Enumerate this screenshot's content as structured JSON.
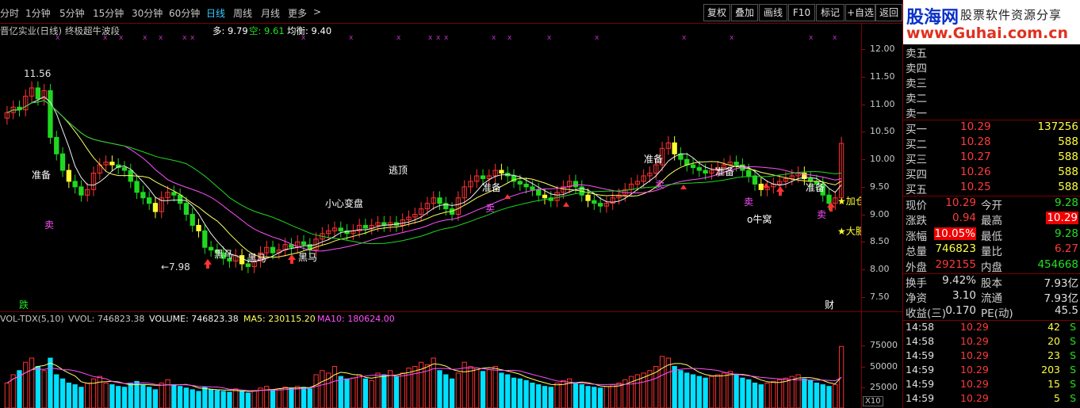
{
  "periods": [
    "分时",
    "1分钟",
    "5分钟",
    "15分钟",
    "30分钟",
    "60分钟",
    "日线",
    "周线",
    "月线",
    "更多"
  ],
  "active_period": "日线",
  "more_arrow": ">",
  "toolbar": {
    "fuquan": "复权",
    "diejia": "叠加",
    "huaxian": "画线",
    "f10": "F10",
    "biaoji": "标记",
    "zixuan": "+自选",
    "fanhui": "返回"
  },
  "chart_title": {
    "name": "晋亿实业(日线)",
    "indicator": "终极超牛波段",
    "duo": "多: 9.79",
    "kong": "空: 9.61",
    "junheng": "均衡: 9.40"
  },
  "price_axis": [
    "12.00",
    "11.50",
    "11.00",
    "10.50",
    "10.00",
    "9.50",
    "9.00",
    "8.50",
    "8.00",
    "7.50"
  ],
  "volume_axis": [
    "75000",
    "50000",
    "25000"
  ],
  "volume_unit": "X10",
  "annotations": {
    "high": "11.56",
    "low": "7.98",
    "zhunbei": "准备",
    "heima": "黑马",
    "xiaoxin": "小心变盘",
    "taoding": "逃顶",
    "mai": "卖",
    "niuwo": "o牛窝",
    "jiacang": "加仓",
    "dapeng": "大肥",
    "die": "跌",
    "cai": "财",
    "xing": "★"
  },
  "volume_legend": {
    "name": "VOL-TDX(5,10)",
    "vvol": "VVOL: 746823.38",
    "volume": "VOLUME: 746823.38",
    "ma5": "MA5: 230115.20",
    "ma10": "MA10: 180624.00"
  },
  "logo": {
    "text1": "股海网",
    "text2": "股票软件资源分享",
    "text3": "www.Guhai.com.cn"
  },
  "sells": [
    {
      "label": "卖五"
    },
    {
      "label": "卖四"
    },
    {
      "label": "卖三"
    },
    {
      "label": "卖二"
    },
    {
      "label": "卖一"
    }
  ],
  "buys": [
    {
      "label": "买一",
      "price": "10.29",
      "vol": "137256"
    },
    {
      "label": "买二",
      "price": "10.28",
      "vol": "588"
    },
    {
      "label": "买三",
      "price": "10.27",
      "vol": "588"
    },
    {
      "label": "买四",
      "price": "10.26",
      "vol": "588"
    },
    {
      "label": "买五",
      "price": "10.25",
      "vol": "588"
    }
  ],
  "quote": [
    {
      "l1": "现价",
      "v1": "10.29",
      "l2": "今开",
      "v2": "9.28"
    },
    {
      "l1": "涨跌",
      "v1": "0.94",
      "l2": "最高",
      "v2": "10.29"
    },
    {
      "l1": "涨幅",
      "v1": "10.05%",
      "l2": "最低",
      "v2": "9.28"
    },
    {
      "l1": "总量",
      "v1": "746823",
      "l2": "量比",
      "v2": "6.27"
    },
    {
      "l1": "外盘",
      "v1": "292155",
      "l2": "内盘",
      "v2": "454668"
    }
  ],
  "fundamentals": [
    {
      "l1": "换手",
      "v1": "9.42%",
      "l2": "股本",
      "v2": "7.93亿"
    },
    {
      "l1": "净资",
      "v1": "3.10",
      "l2": "流通",
      "v2": "7.93亿"
    },
    {
      "l1": "收益(三)",
      "v1": "0.170",
      "l2": "PE(动)",
      "v2": "45.5"
    }
  ],
  "ticks": [
    {
      "time": "14:58",
      "price": "10.29",
      "vol": "42",
      "dir": "S"
    },
    {
      "time": "14:58",
      "price": "10.29",
      "vol": "20",
      "dir": "S"
    },
    {
      "time": "14:59",
      "price": "10.29",
      "vol": "23",
      "dir": "S"
    },
    {
      "time": "14:59",
      "price": "10.29",
      "vol": "203",
      "dir": "S"
    },
    {
      "time": "14:59",
      "price": "10.29",
      "vol": "15",
      "dir": "S"
    },
    {
      "time": "14:59",
      "price": "10.29",
      "vol": "5",
      "dir": "S"
    }
  ],
  "colors": {
    "up": "#ff3232",
    "down": "#00e0ff",
    "green": "#20d820",
    "yellow": "#ffff30",
    "ma_white": "#f0f0f0",
    "ma_yellow": "#ffff60",
    "ma_pink": "#ff50ff",
    "border": "#7a0000"
  },
  "chart_data": {
    "type": "candlestick",
    "price_range": [
      7.25,
      12.25
    ],
    "close": [
      10.85,
      10.95,
      10.9,
      11.15,
      11.3,
      11.1,
      11.25,
      10.4,
      10.1,
      9.8,
      9.6,
      9.5,
      9.35,
      9.45,
      9.75,
      9.9,
      9.95,
      9.9,
      9.85,
      9.8,
      9.6,
      9.4,
      9.3,
      9.2,
      9.05,
      9.3,
      9.4,
      9.35,
      9.2,
      9.0,
      8.8,
      8.7,
      8.4,
      8.35,
      8.3,
      8.2,
      8.15,
      8.25,
      8.1,
      8.05,
      8.15,
      8.3,
      8.4,
      8.3,
      8.35,
      8.45,
      8.4,
      8.5,
      8.45,
      8.35,
      8.55,
      8.65,
      8.7,
      8.75,
      8.7,
      8.65,
      8.7,
      8.8,
      8.75,
      8.8,
      8.85,
      8.8,
      8.85,
      8.8,
      8.9,
      8.95,
      9.0,
      9.1,
      9.2,
      9.3,
      9.2,
      9.1,
      9.0,
      9.3,
      9.5,
      9.6,
      9.7,
      9.65,
      9.7,
      9.8,
      9.75,
      9.7,
      9.6,
      9.55,
      9.5,
      9.45,
      9.35,
      9.3,
      9.25,
      9.4,
      9.5,
      9.6,
      9.5,
      9.35,
      9.25,
      9.2,
      9.15,
      9.2,
      9.3,
      9.35,
      9.45,
      9.55,
      9.6,
      9.7,
      9.75,
      9.9,
      10.2,
      10.3,
      10.1,
      10.0,
      9.9,
      9.85,
      9.8,
      9.75,
      9.8,
      9.85,
      9.9,
      9.95,
      9.9,
      9.8,
      9.7,
      9.55,
      9.45,
      9.5,
      9.55,
      9.6,
      9.65,
      9.7,
      9.75,
      9.65,
      9.6,
      9.55,
      9.35,
      9.2,
      9.3,
      10.29
    ],
    "volume": [
      30000,
      40000,
      45000,
      55000,
      60000,
      50000,
      45000,
      60000,
      40000,
      35000,
      30000,
      28000,
      25000,
      30000,
      35000,
      38000,
      30000,
      28000,
      26000,
      25000,
      30000,
      32000,
      28000,
      25000,
      22000,
      30000,
      34000,
      28000,
      26000,
      24000,
      22000,
      20000,
      25000,
      22000,
      21000,
      20000,
      19000,
      23000,
      20000,
      18000,
      21000,
      24000,
      26000,
      22000,
      23000,
      25000,
      24000,
      26000,
      25000,
      23000,
      40000,
      45000,
      42000,
      50000,
      38000,
      35000,
      36000,
      40000,
      35000,
      33000,
      42000,
      40000,
      45000,
      38000,
      42000,
      48000,
      50000,
      55000,
      52000,
      60000,
      45000,
      40000,
      35000,
      42000,
      55000,
      50000,
      48000,
      44000,
      46000,
      50000,
      42000,
      40000,
      36000,
      35000,
      33000,
      30000,
      28000,
      26000,
      25000,
      30000,
      33000,
      35000,
      30000,
      28000,
      26000,
      25000,
      24000,
      26000,
      28000,
      30000,
      34000,
      38000,
      40000,
      42000,
      45000,
      50000,
      62000,
      60000,
      50000,
      45000,
      42000,
      40000,
      38000,
      36000,
      38000,
      40000,
      42000,
      44000,
      40000,
      36000,
      34000,
      30000,
      28000,
      30000,
      32000,
      34000,
      36000,
      38000,
      40000,
      35000,
      33000,
      30000,
      28000,
      26000,
      28000,
      74000
    ]
  }
}
